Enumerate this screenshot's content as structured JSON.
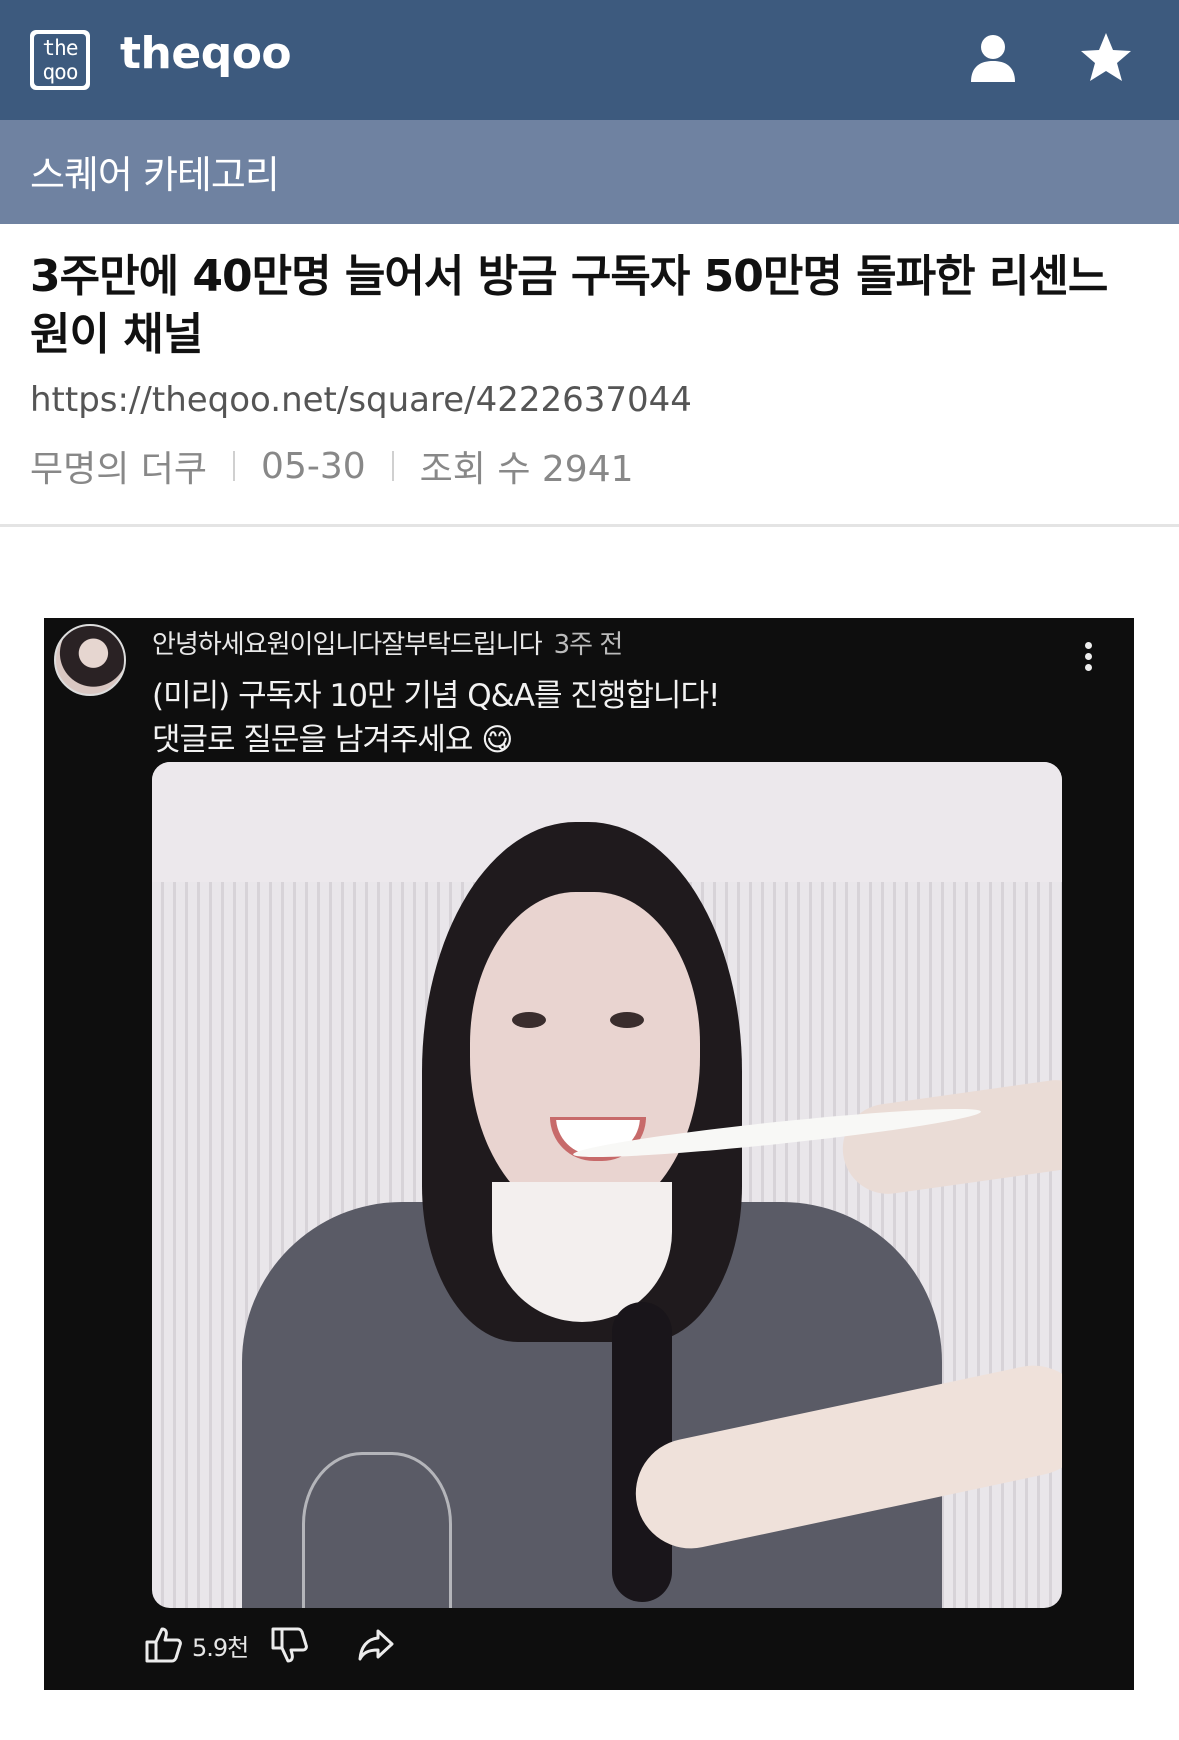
{
  "header": {
    "logo_text_top": "the",
    "logo_text_bottom": "qoo",
    "brand": "theqoo",
    "icons": [
      "user-icon",
      "star-icon"
    ]
  },
  "category": {
    "label": "스퀘어 카테고리"
  },
  "article": {
    "title": "3주만에 40만명 늘어서 방금 구독자 50만명 돌파한 리센느 원이 채널",
    "url": "https://theqoo.net/square/4222637044",
    "author": "무명의 더쿠",
    "date": "05-30",
    "views_label": "조회 수 2941"
  },
  "embedded_post": {
    "channel_name": "안녕하세요원이입니다잘부탁드립니다",
    "posted_ago": "3주 전",
    "line1": "(미리) 구독자 10만 기념 Q&A를 진행합니다!",
    "line2": "댓글로 질문을 남겨주세요 😋",
    "like_count": "5.9천",
    "icons": [
      "avatar",
      "more-vertical-icon",
      "thumbs-up-icon",
      "thumbs-down-icon",
      "share-icon"
    ]
  },
  "colors": {
    "header_bg": "#3d5a7e",
    "category_bg": "#6f82a1",
    "embed_bg": "#0e0e0e"
  }
}
